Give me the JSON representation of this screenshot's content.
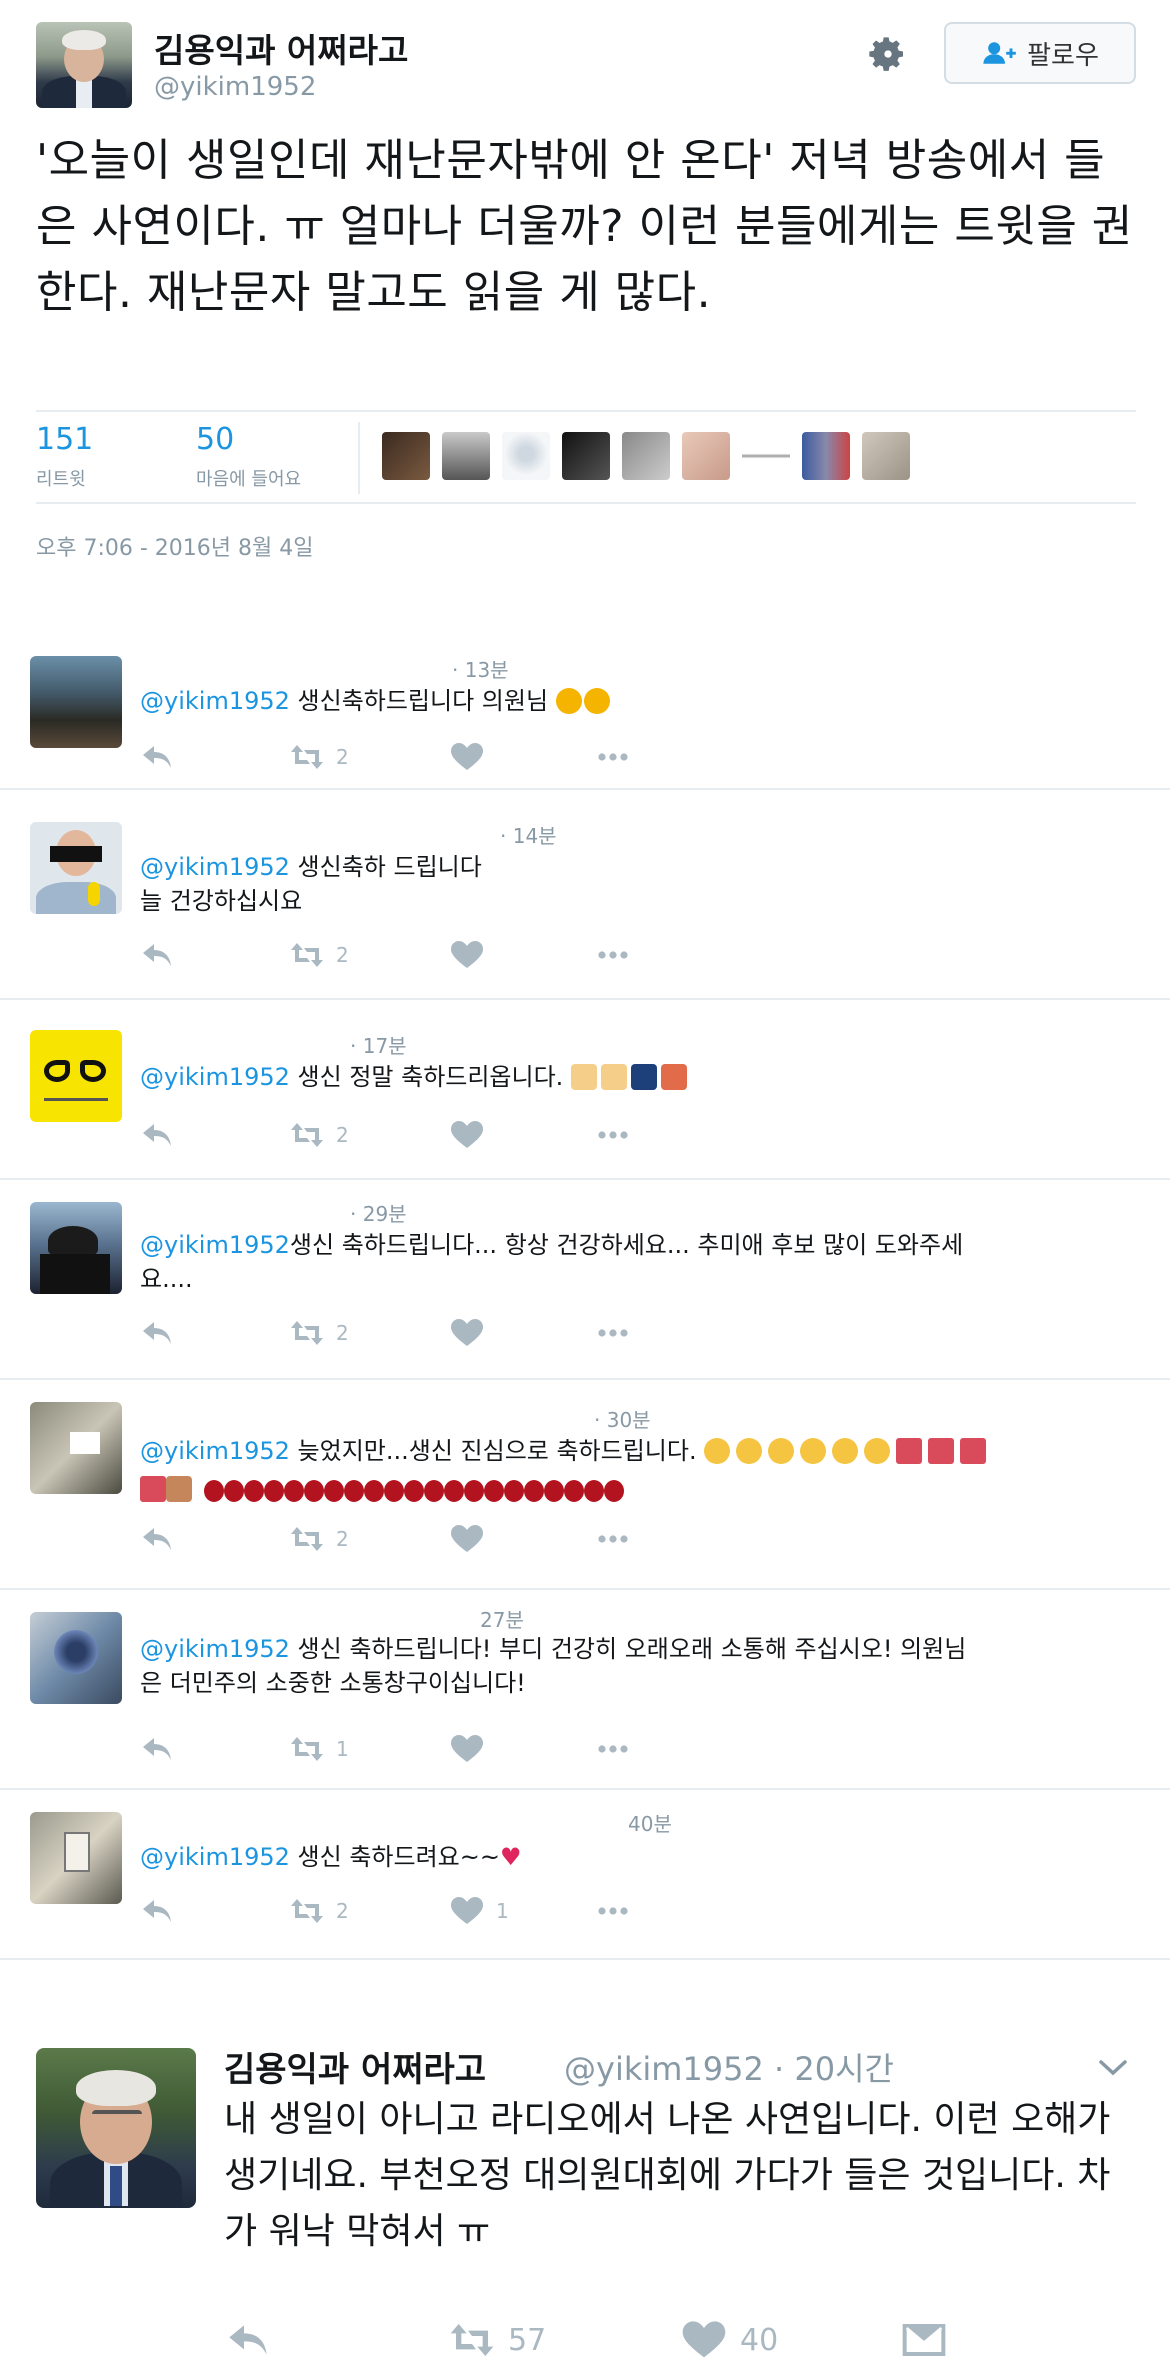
{
  "main": {
    "name": "김용익과 어쩌라고",
    "handle": "@yikim1952",
    "follow_label": "팔로우",
    "text": "'오늘이 생일인데 재난문자밖에 안 온다' 저녁 방송에서 들은 사연이다. ㅠ 얼마나 더울까? 이런 분들에게는 트윗을 권한다. 재난문자 말고도 읽을 게 많다.",
    "retweets": {
      "count": "151",
      "label": "리트윗"
    },
    "likes": {
      "count": "50",
      "label": "마음에 들어요"
    },
    "timestamp": "오후 7:06 - 2016년 8월 4일"
  },
  "replies": [
    {
      "time": "· 13분",
      "mention": "@yikim1952",
      "text": " 생신축하드립니다 의원님",
      "retweets": "2",
      "likes": ""
    },
    {
      "time": "· 14분",
      "mention": "@yikim1952",
      "text": " 생신축하 드립니다",
      "text2": "늘 건강하십시요",
      "retweets": "2",
      "likes": ""
    },
    {
      "time": "· 17분",
      "mention": "@yikim1952",
      "text": " 생신 정말 축하드리옵니다.",
      "retweets": "2",
      "likes": ""
    },
    {
      "time": "· 29분",
      "mention": "@yikim1952",
      "text": "생신 축하드립니다... 항상 건강하세요... 추미애 후보 많이 도와주세",
      "text2": "요....",
      "retweets": "2",
      "likes": ""
    },
    {
      "time": "· 30분",
      "mention": "@yikim1952",
      "text": " 늦었지만...생신 진심으로 축하드립니다.",
      "retweets": "2",
      "likes": ""
    },
    {
      "time": "27분",
      "mention": "@yikim1952",
      "text": " 생신 축하드립니다! 부디 건강히 오래오래 소통해 주십시오! 의원님",
      "text2": "은 더민주의 소중한 소통창구이십니다!",
      "retweets": "1",
      "likes": ""
    },
    {
      "time": "40분",
      "mention": "@yikim1952",
      "text": " 생신 축하드려요~~",
      "retweets": "2",
      "likes": "1"
    }
  ],
  "bottom": {
    "name": "김용익과 어쩌라고",
    "handle": "@yikim1952 · 20시간",
    "text": "내 생일이 아니고 라디오에서 나온 사연입니다. 이런 오해가 생기네요. 부천오정 대의원대회에 가다가 들은 것입니다. 차가 워낙 막혀서 ㅠ",
    "retweets": "57",
    "likes": "40"
  },
  "colors": {
    "accent": "#1b95e0",
    "muted": "#8899a6",
    "icon": "#aab8c2",
    "border": "#e6ecf0"
  },
  "icons": [
    "gear-icon",
    "follow-icon",
    "reply-icon",
    "retweet-icon",
    "heart-icon",
    "more-icon",
    "chevron-down-icon",
    "dm-icon"
  ]
}
